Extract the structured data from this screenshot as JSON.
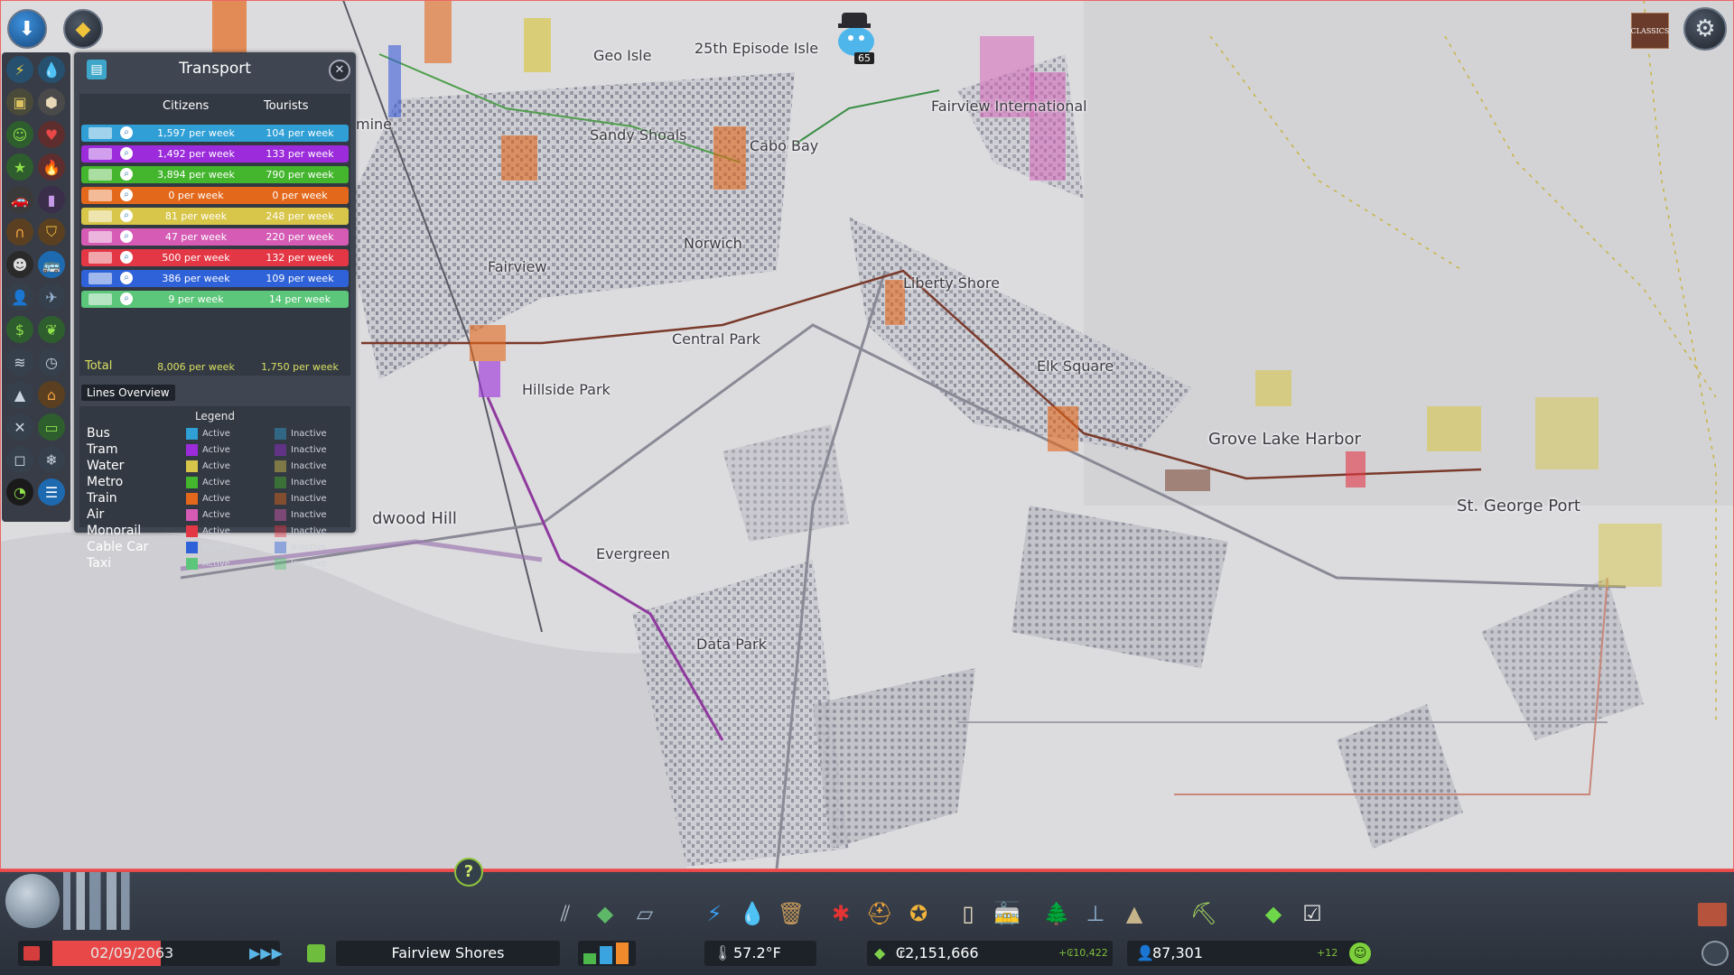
{
  "colors": {
    "bus": "#2f9fd6",
    "tram": "#9c2bdb",
    "water": "#d8c64a",
    "metro": "#44b62e",
    "train": "#e4681b",
    "air": "#d55bb5",
    "monorail": "#e33745",
    "cable_car": "#2f62d8",
    "taxi": "#5cc67a",
    "bottom_accent": "#e74a4a"
  },
  "top_icons": {
    "unlock_icon": "download-arrow-icon",
    "milestones_icon": "milestone-icon",
    "chirper_count": "65",
    "classics_label": "CLASSICS",
    "settings_icon": "gear-icon"
  },
  "map": {
    "labels": [
      {
        "text": "Geo Isle"
      },
      {
        "text": "25th Episode Isle"
      },
      {
        "text": "Fairview International"
      },
      {
        "text": "Sandy Shoals"
      },
      {
        "text": "Cabo Bay"
      },
      {
        "text": "mine"
      },
      {
        "text": "Norwich"
      },
      {
        "text": "Fairview"
      },
      {
        "text": "Liberty Shore"
      },
      {
        "text": "Central Park"
      },
      {
        "text": "Elk Square"
      },
      {
        "text": "Hillside Park"
      },
      {
        "text": "Grove Lake Harbor"
      },
      {
        "text": "St. George Port"
      },
      {
        "text": "dwood Hill"
      },
      {
        "text": "Evergreen"
      },
      {
        "text": "Data Park"
      }
    ]
  },
  "transport_panel": {
    "title": "Transport",
    "col_citizens": "Citizens",
    "col_tourists": "Tourists",
    "rows": [
      {
        "mode": "bus",
        "color": "#2f9fd6",
        "citizens": "1,597 per week",
        "tourists": "104 per week"
      },
      {
        "mode": "tram",
        "color": "#9c2bdb",
        "citizens": "1,492 per week",
        "tourists": "133 per week"
      },
      {
        "mode": "metro",
        "color": "#44b62e",
        "citizens": "3,894 per week",
        "tourists": "790 per week"
      },
      {
        "mode": "train",
        "color": "#e4681b",
        "citizens": "0 per week",
        "tourists": "0 per week"
      },
      {
        "mode": "ship",
        "color": "#d8c64a",
        "citizens": "81 per week",
        "tourists": "248 per week"
      },
      {
        "mode": "air",
        "color": "#d55bb5",
        "citizens": "47 per week",
        "tourists": "220 per week"
      },
      {
        "mode": "monorail",
        "color": "#e33745",
        "citizens": "500 per week",
        "tourists": "132 per week"
      },
      {
        "mode": "cable-car",
        "color": "#2f62d8",
        "citizens": "386 per week",
        "tourists": "109 per week"
      },
      {
        "mode": "taxi",
        "color": "#5cc67a",
        "citizens": "9 per week",
        "tourists": "14 per week"
      }
    ],
    "total_label": "Total",
    "total_citizens": "8,006 per week",
    "total_tourists": "1,750 per week",
    "lines_overview": "Lines Overview",
    "legend_title": "Legend",
    "legend": [
      {
        "name": "Bus",
        "color": "#2f9fd6",
        "active": "Active",
        "inactive": "Inactive"
      },
      {
        "name": "Tram",
        "color": "#9c2bdb",
        "active": "Active",
        "inactive": "Inactive"
      },
      {
        "name": "Water",
        "color": "#d8c64a",
        "active": "Active",
        "inactive": "Inactive"
      },
      {
        "name": "Metro",
        "color": "#44b62e",
        "active": "Active",
        "inactive": "Inactive"
      },
      {
        "name": "Train",
        "color": "#e4681b",
        "active": "Active",
        "inactive": "Inactive"
      },
      {
        "name": "Air",
        "color": "#d55bb5",
        "active": "Active",
        "inactive": "Inactive"
      },
      {
        "name": "Monorail",
        "color": "#e33745",
        "active": "Active",
        "inactive": "Inactive"
      },
      {
        "name": "Cable Car",
        "color": "#2f62d8",
        "active": "Active",
        "inactive": "Inactive"
      },
      {
        "name": "Taxi",
        "color": "#5cc67a",
        "active": "Active",
        "inactive": "Inactive"
      }
    ]
  },
  "left_toolbar": {
    "icons": [
      "electricity-icon",
      "water-icon",
      "garbage-icon",
      "buildings-icon",
      "happiness-icon",
      "health-icon",
      "attractiveness-icon",
      "fire-icon",
      "traffic-icon",
      "pollution-icon",
      "noise-icon",
      "police-icon",
      "crime-icon",
      "transport-icon",
      "population-icon",
      "tourism-icon",
      "money-icon",
      "nature-icon",
      "wind-icon",
      "clock-icon",
      "terrain-icon",
      "dam-icon",
      "tools-icon",
      "road-icon",
      "camera-icon",
      "snow-icon",
      "radar-icon",
      "routes-icon"
    ]
  },
  "bottom_bar": {
    "help_label": "?",
    "date": "02/09/2063",
    "city_name": "Fairview Shores",
    "temperature": "57.2°F",
    "money": "₢2,151,666",
    "money_delta": "+₢10,422",
    "population": "87,301",
    "population_delta": "+12",
    "toolbar_icons": [
      "roads-icon",
      "zoning-icon",
      "districts-icon",
      "electricity-icon",
      "water-icon",
      "garbage-icon",
      "healthcare-icon",
      "fire-icon",
      "police-icon",
      "education-icon",
      "transport-icon",
      "parks-icon",
      "monuments-icon",
      "landscaping-icon",
      "bulldozer-icon",
      "money-icon",
      "policies-icon"
    ]
  }
}
